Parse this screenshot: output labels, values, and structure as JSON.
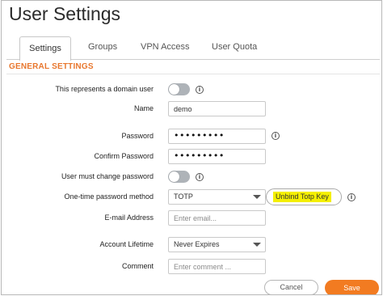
{
  "page": {
    "title": "User Settings"
  },
  "tabs": [
    {
      "label": "Settings",
      "active": true
    },
    {
      "label": "Groups",
      "active": false
    },
    {
      "label": "VPN Access",
      "active": false
    },
    {
      "label": "User Quota",
      "active": false
    }
  ],
  "section": {
    "header": "GENERAL SETTINGS"
  },
  "fields": {
    "domain_user": {
      "label": "This represents a domain user",
      "enabled": false
    },
    "name": {
      "label": "Name",
      "value": "demo"
    },
    "password": {
      "label": "Password",
      "value": "•••••••••"
    },
    "confirm_password": {
      "label": "Confirm Password",
      "value": "•••••••••"
    },
    "must_change_password": {
      "label": "User must change password",
      "enabled": false
    },
    "otp_method": {
      "label": "One-time password method",
      "value": "TOTP",
      "action_label": "Unbind Totp Key"
    },
    "email": {
      "label": "E-mail Address",
      "placeholder": "Enter email..."
    },
    "account_lifetime": {
      "label": "Account Lifetime",
      "value": "Never Expires"
    },
    "comment": {
      "label": "Comment",
      "placeholder": "Enter comment ..."
    }
  },
  "footer": {
    "cancel_label": "Cancel",
    "save_label": "Save"
  },
  "colors": {
    "accent": "#f27b21",
    "section_header": "#e8772e",
    "highlight": "#f4ef00",
    "toggle_off": "#aeb3b8"
  },
  "icons": {
    "info": "info-icon",
    "dropdown": "chevron-down-icon"
  }
}
